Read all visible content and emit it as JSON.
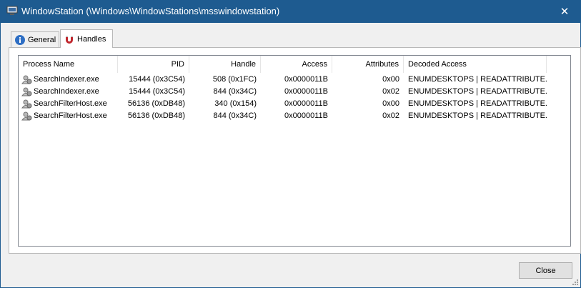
{
  "window": {
    "title": "WindowStation (\\Windows\\WindowStations\\msswindowstation)",
    "close_glyph": "✕"
  },
  "tabs": [
    {
      "label": "General",
      "icon": "info-icon",
      "selected": false
    },
    {
      "label": "Handles",
      "icon": "magnet-icon",
      "selected": true
    }
  ],
  "table": {
    "columns": [
      "Process Name",
      "PID",
      "Handle",
      "Access",
      "Attributes",
      "Decoded Access"
    ],
    "rows": [
      {
        "process": "SearchIndexer.exe",
        "pid": "15444 (0x3C54)",
        "handle": "508 (0x1FC)",
        "access": "0x0000011B",
        "attributes": "0x00",
        "decoded": "ENUMDESKTOPS | READATTRIBUTE..."
      },
      {
        "process": "SearchIndexer.exe",
        "pid": "15444 (0x3C54)",
        "handle": "844 (0x34C)",
        "access": "0x0000011B",
        "attributes": "0x02",
        "decoded": "ENUMDESKTOPS | READATTRIBUTE..."
      },
      {
        "process": "SearchFilterHost.exe",
        "pid": "56136 (0xDB48)",
        "handle": "340 (0x154)",
        "access": "0x0000011B",
        "attributes": "0x00",
        "decoded": "ENUMDESKTOPS | READATTRIBUTE..."
      },
      {
        "process": "SearchFilterHost.exe",
        "pid": "56136 (0xDB48)",
        "handle": "844 (0x34C)",
        "access": "0x0000011B",
        "attributes": "0x02",
        "decoded": "ENUMDESKTOPS | READATTRIBUTE..."
      }
    ]
  },
  "buttons": {
    "close": "Close"
  },
  "colors": {
    "titlebar": "#1e5b90",
    "window_bg": "#f0f0f0"
  }
}
